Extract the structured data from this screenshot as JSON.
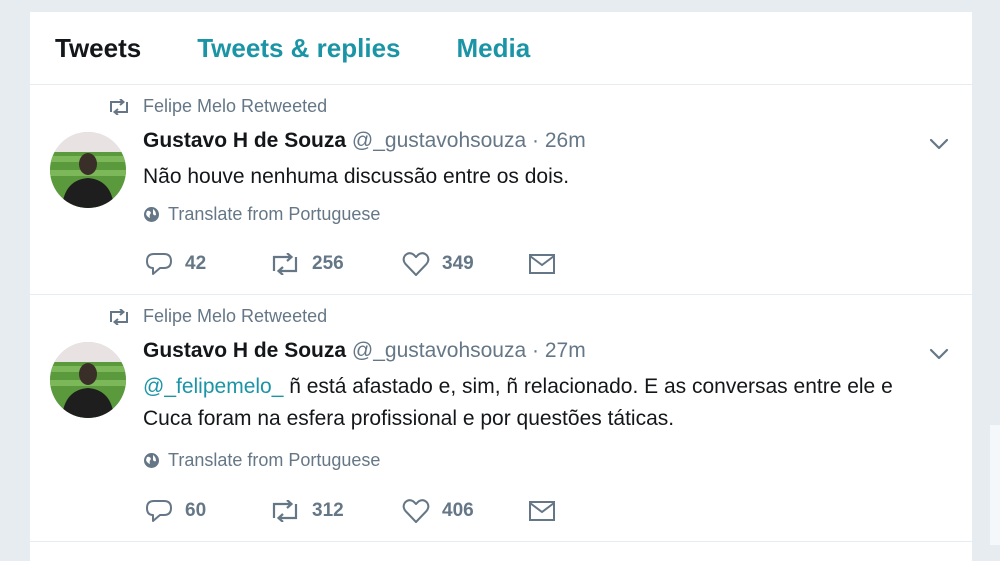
{
  "tabs": [
    {
      "label": "Tweets",
      "active": true
    },
    {
      "label": "Tweets & replies",
      "active": false
    },
    {
      "label": "Media",
      "active": false
    }
  ],
  "tweets": [
    {
      "retweeted_by": "Felipe Melo Retweeted",
      "name": "Gustavo H de Souza",
      "handle": "@_gustavohsouza",
      "separator": "·",
      "time": "26m",
      "mention": "",
      "text": "Não houve nenhuma discussão entre os dois.",
      "translate": "Translate from Portuguese",
      "replies": "42",
      "retweets": "256",
      "likes": "349"
    },
    {
      "retweeted_by": "Felipe Melo Retweeted",
      "name": "Gustavo H de Souza",
      "handle": "@_gustavohsouza",
      "separator": "·",
      "time": "27m",
      "mention": "@_felipemelo_",
      "text": " ñ está afastado e, sim, ñ relacionado. E as conversas entre ele e Cuca foram na esfera profissional e por questões táticas.",
      "translate": "Translate from Portuguese",
      "replies": "60",
      "retweets": "312",
      "likes": "406"
    }
  ],
  "colors": {
    "accent": "#1b95a6",
    "muted": "#657786",
    "text": "#14171a",
    "background": "#e6ecf0"
  },
  "icons": [
    "retweet-icon",
    "chevron-down-icon",
    "globe-icon",
    "reply-icon",
    "like-icon",
    "message-icon",
    "avatar"
  ]
}
